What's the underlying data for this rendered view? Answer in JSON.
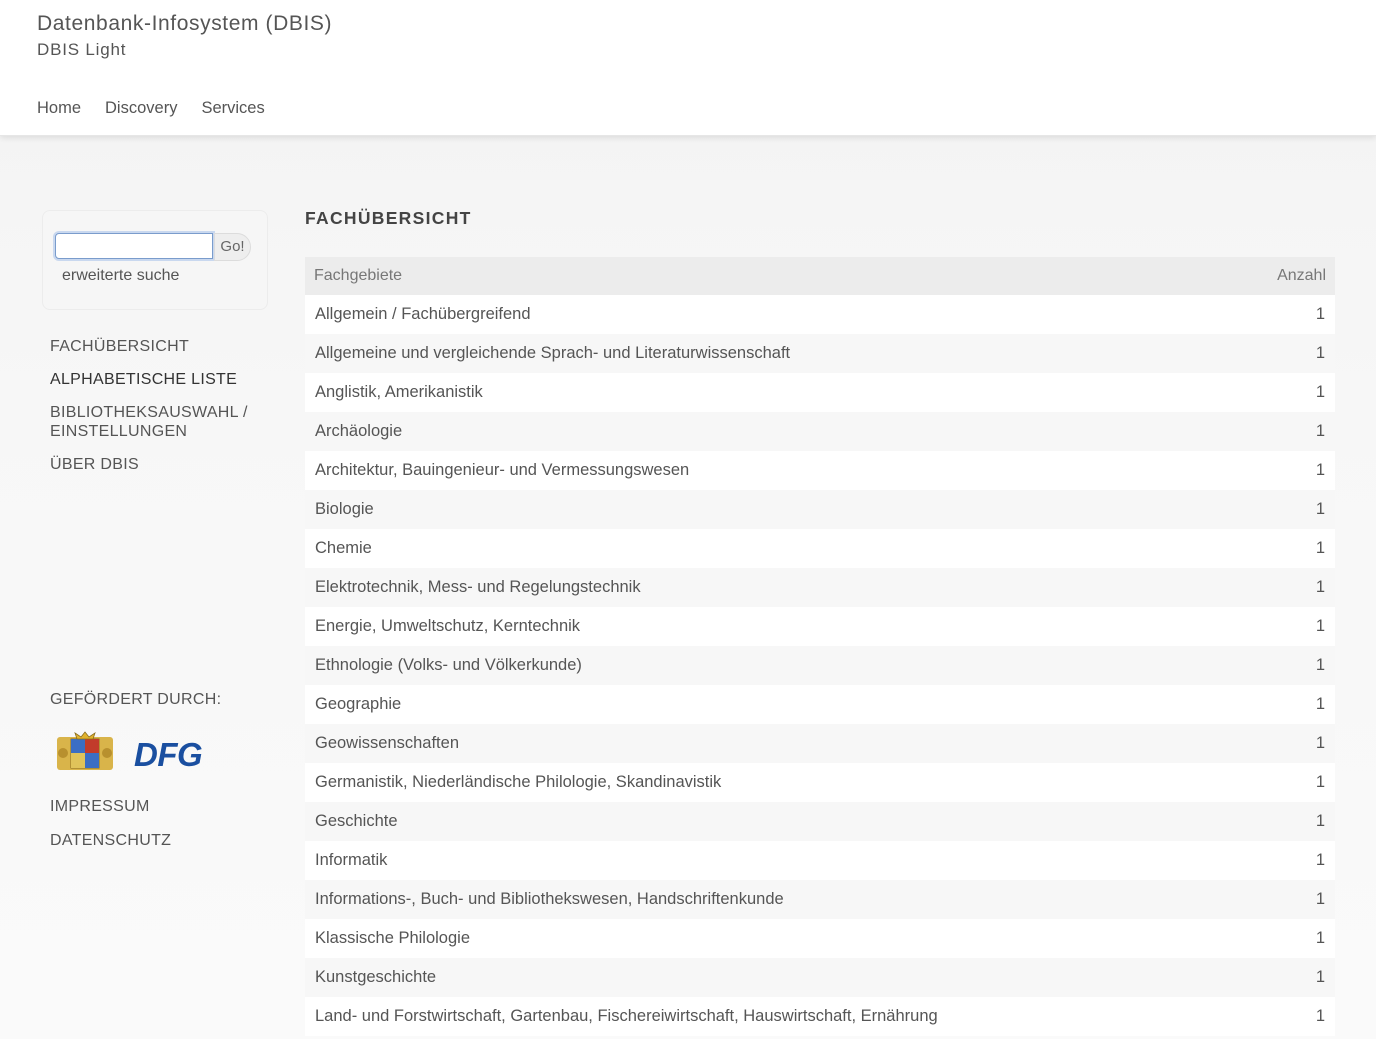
{
  "header": {
    "title": "Datenbank-Infosystem (DBIS)",
    "subtitle": "DBIS Light",
    "nav": [
      "Home",
      "Discovery",
      "Services"
    ]
  },
  "search": {
    "value": "",
    "button": "Go!",
    "advanced": "erweiterte suche"
  },
  "sidebar": {
    "items": [
      "FACHÜBERSICHT",
      "ALPHABETISCHE LISTE",
      "BIBLIOTHEKSAUSWAHL / EINSTELLUNGEN",
      "ÜBER DBIS"
    ],
    "funded_by": "GEFÖRDERT DURCH:",
    "logo_dfg": "DFG",
    "footer": [
      "IMPRESSUM",
      "DATENSCHUTZ"
    ]
  },
  "main": {
    "heading": "FACHÜBERSICHT",
    "columns": [
      "Fachgebiete",
      "Anzahl"
    ],
    "rows": [
      [
        "Allgemein / Fachübergreifend",
        "1"
      ],
      [
        "Allgemeine und vergleichende Sprach- und Literaturwissenschaft",
        "1"
      ],
      [
        "Anglistik, Amerikanistik",
        "1"
      ],
      [
        "Archäologie",
        "1"
      ],
      [
        "Architektur, Bauingenieur- und Vermessungswesen",
        "1"
      ],
      [
        "Biologie",
        "1"
      ],
      [
        "Chemie",
        "1"
      ],
      [
        "Elektrotechnik, Mess- und Regelungstechnik",
        "1"
      ],
      [
        "Energie, Umweltschutz, Kerntechnik",
        "1"
      ],
      [
        "Ethnologie (Volks- und Völkerkunde)",
        "1"
      ],
      [
        "Geographie",
        "1"
      ],
      [
        "Geowissenschaften",
        "1"
      ],
      [
        "Germanistik, Niederländische Philologie, Skandinavistik",
        "1"
      ],
      [
        "Geschichte",
        "1"
      ],
      [
        "Informatik",
        "1"
      ],
      [
        "Informations-, Buch- und Bibliothekswesen, Handschriftenkunde",
        "1"
      ],
      [
        "Klassische Philologie",
        "1"
      ],
      [
        "Kunstgeschichte",
        "1"
      ],
      [
        "Land- und Forstwirtschaft, Gartenbau, Fischereiwirtschaft, Hauswirtschaft, Ernährung",
        "1"
      ]
    ]
  }
}
